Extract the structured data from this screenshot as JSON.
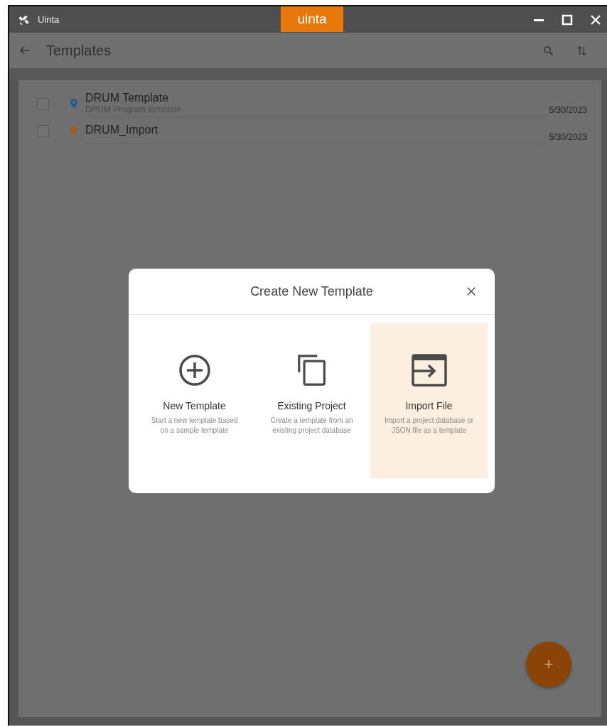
{
  "window": {
    "title": "Uinta",
    "logo": "uinta"
  },
  "app_bar": {
    "title": "Templates"
  },
  "templates": [
    {
      "name": "DRUM Template",
      "description": "DRUM Program template",
      "date": "5/30/2023",
      "checked": false,
      "color": "#1f5f95"
    },
    {
      "name": "DRUM_Import",
      "date": "5/30/2023",
      "checked": false,
      "color": "#a85a14"
    }
  ],
  "dialog": {
    "title": "Create New Template",
    "options": [
      {
        "kind": "new",
        "title": "New Template",
        "description": "Start a new template based on a sample template",
        "selected": false
      },
      {
        "kind": "existing",
        "title": "Existing Project",
        "description": "Create a template from an existing project database",
        "selected": false
      },
      {
        "kind": "import",
        "title": "Import File",
        "description": "Import a project database or JSON file as a template",
        "selected": true
      }
    ]
  },
  "fab": {
    "label": "+"
  }
}
